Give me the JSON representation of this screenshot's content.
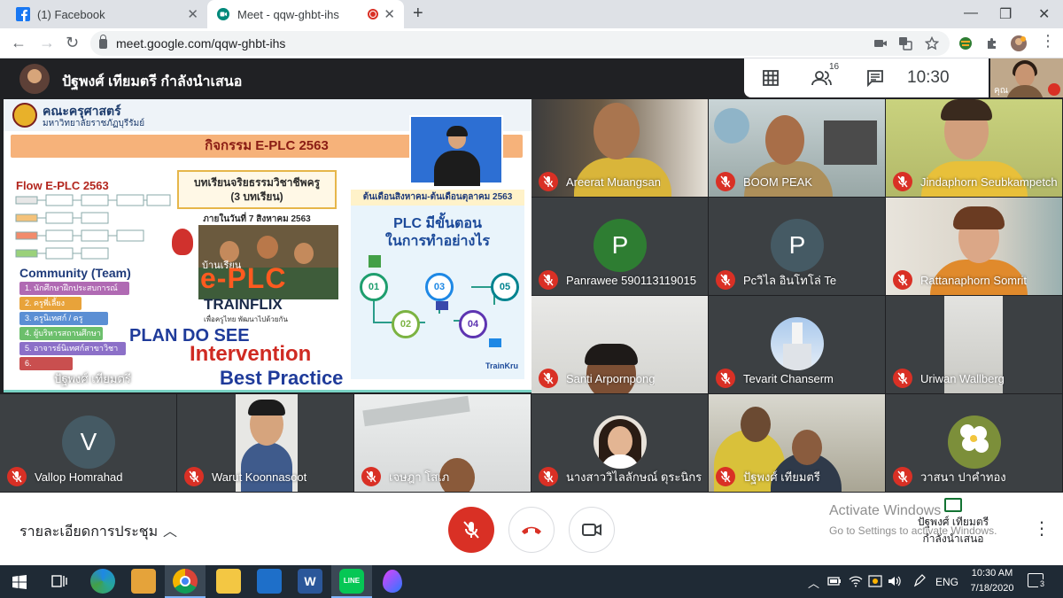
{
  "browser": {
    "tabs": [
      {
        "title": "(1) Facebook",
        "active": false
      },
      {
        "title": "Meet - qqw-ghbt-ihs",
        "active": true
      }
    ],
    "url": "meet.google.com/qqw-ghbt-ihs"
  },
  "meet": {
    "presenting_title": "ปัฐพงศ์ เทียมตรี กำลังนำเสนอ",
    "participant_count": "16",
    "time": "10:30",
    "self_label": "คุณ",
    "presentation": {
      "faculty": "คณะครุศาสตร์",
      "university": "มหาวิทยาลัยราชภัฏบุรีรัมย์",
      "activity": "กิจกรรม E-PLC 2563",
      "flow_title": "Flow E-PLC 2563",
      "lesson_line1": "บทเรียนจริยธรรมวิชาชีพครู",
      "lesson_line2": "(3 บทเรียน)",
      "lesson_date": "ภายในวันที่ 7 สิงหาคม 2563",
      "months": "ต้นเดือนสิงหาคม-ต้นเดือนตุลาคม 2563",
      "plc_line1": "PLC มีขั้นตอน",
      "plc_line2": "ในการทำอย่างไร",
      "steps": [
        "01",
        "02",
        "03",
        "04",
        "05"
      ],
      "baan": "บ้านเรียน",
      "eplc": "e-PLC",
      "trainflix": "TRAINFLIX",
      "trainflix_sub": "เพื่อครูไทย พัฒนาไปด้วยกัน",
      "community_title": "Community (Team)",
      "community_items": [
        "1. นักศึกษาฝึกประสบการณ์วิชาชีพครู",
        "2. ครูพี่เลี้ยง",
        "3. ครูนิเทศก์ / ครูวิชาการ",
        "4. ผู้บริหารสถานศึกษา",
        "5. อาจารย์นิเทศก์สาขาวิชาภาคกลาง",
        "6. ศึกษานิเทศก์"
      ],
      "pds": "PLAN  DO  SEE",
      "intervention": "Intervention",
      "best_practice": "Best Practice",
      "trainkru": "TrainKru",
      "presenter_name": "ปัฐพงศ์ เทียมตรี"
    },
    "tiles": [
      {
        "name": "Areerat Muangsan",
        "muted": true
      },
      {
        "name": "BOOM PEAK",
        "muted": true
      },
      {
        "name": "Jindaphorn Seubkampetch",
        "muted": true
      },
      {
        "name": "Panrawee 590113119015",
        "muted": true,
        "letter": "P",
        "color": "#2e7d32"
      },
      {
        "name": "Pcวิไล อินโทโล่ Te",
        "muted": true,
        "letter": "P",
        "color": "#455a64"
      },
      {
        "name": "Rattanaphorn Somrit",
        "muted": true
      },
      {
        "name": "Santi Arpornpong",
        "muted": true
      },
      {
        "name": "Tevarit Chanserm",
        "muted": true
      },
      {
        "name": "Uriwan Wallberg",
        "muted": true
      },
      {
        "name": "Vallop Homrahad",
        "muted": true,
        "letter": "V",
        "color": "#455a64"
      },
      {
        "name": "Warut Koonnasoot",
        "muted": true
      },
      {
        "name": "เจษฎา โสเภ",
        "muted": true
      },
      {
        "name": "นางสาววิไลลักษณ์ ดุระนิกร",
        "muted": true
      },
      {
        "name": "ปัฐพงศ์ เทียมตรี",
        "muted": true
      },
      {
        "name": "วาสนา ปาคำทอง",
        "muted": true
      }
    ],
    "bottom": {
      "details": "รายละเอียดการประชุม",
      "presenting_line1": "ปัฐพงศ์ เทียมตรี",
      "presenting_line2": "กำลังนำเสนอ"
    }
  },
  "windows": {
    "activate_title": "Activate Windows",
    "activate_sub": "Go to Settings to activate Windows.",
    "lang": "ENG",
    "clock_time": "10:30 AM",
    "clock_date": "7/18/2020",
    "notifications": "3"
  },
  "colors": {
    "meet_bg": "#202124",
    "tile_bg": "#3c4043",
    "mute_red": "#d93025"
  }
}
